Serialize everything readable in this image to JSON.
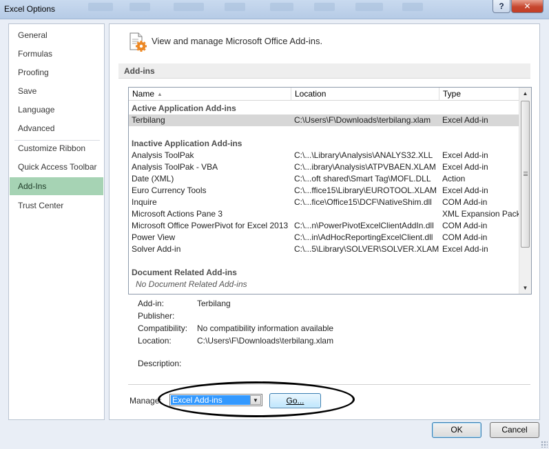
{
  "window": {
    "title": "Excel Options",
    "help_label": "?",
    "close_label": "✕"
  },
  "nav": {
    "items": [
      {
        "label": "General"
      },
      {
        "label": "Formulas"
      },
      {
        "label": "Proofing"
      },
      {
        "label": "Save"
      },
      {
        "label": "Language"
      },
      {
        "label": "Advanced"
      },
      {
        "label": "Customize Ribbon"
      },
      {
        "label": "Quick Access Toolbar"
      },
      {
        "label": "Add-Ins"
      },
      {
        "label": "Trust Center"
      }
    ],
    "active": "Add-Ins"
  },
  "main": {
    "header_text": "View and manage Microsoft Office Add-ins.",
    "section_title": "Add-ins",
    "columns": {
      "name": "Name",
      "location": "Location",
      "type": "Type"
    },
    "groups": {
      "active": "Active Application Add-ins",
      "inactive": "Inactive Application Add-ins",
      "document": "Document Related Add-ins"
    },
    "active_rows": [
      {
        "name": "Terbilang",
        "location": "C:\\Users\\F\\Downloads\\terbilang.xlam",
        "type": "Excel Add-in"
      }
    ],
    "inactive_rows": [
      {
        "name": "Analysis ToolPak",
        "location": "C:\\...\\Library\\Analysis\\ANALYS32.XLL",
        "type": "Excel Add-in"
      },
      {
        "name": "Analysis ToolPak - VBA",
        "location": "C:\\...ibrary\\Analysis\\ATPVBAEN.XLAM",
        "type": "Excel Add-in"
      },
      {
        "name": "Date (XML)",
        "location": "C:\\...oft shared\\Smart Tag\\MOFL.DLL",
        "type": "Action"
      },
      {
        "name": "Euro Currency Tools",
        "location": "C:\\...ffice15\\Library\\EUROTOOL.XLAM",
        "type": "Excel Add-in"
      },
      {
        "name": "Inquire",
        "location": "C:\\...fice\\Office15\\DCF\\NativeShim.dll",
        "type": "COM Add-in"
      },
      {
        "name": "Microsoft Actions Pane 3",
        "location": "",
        "type": "XML Expansion Pack"
      },
      {
        "name": "Microsoft Office PowerPivot for Excel 2013",
        "location": "C:\\...n\\PowerPivotExcelClientAddIn.dll",
        "type": "COM Add-in"
      },
      {
        "name": "Power View",
        "location": "C:\\...in\\AdHocReportingExcelClient.dll",
        "type": "COM Add-in"
      },
      {
        "name": "Solver Add-in",
        "location": "C:\\...5\\Library\\SOLVER\\SOLVER.XLAM",
        "type": "Excel Add-in"
      }
    ],
    "document_empty": "No Document Related Add-ins",
    "details": [
      {
        "label": "Add-in:",
        "value": "Terbilang"
      },
      {
        "label": "Publisher:",
        "value": ""
      },
      {
        "label": "Compatibility:",
        "value": "No compatibility information available"
      },
      {
        "label": "Location:",
        "value": "C:\\Users\\F\\Downloads\\terbilang.xlam"
      },
      {
        "label": "Description:",
        "value": ""
      }
    ],
    "manage": {
      "label": "Manage:",
      "selected": "Excel Add-ins",
      "go_label": "Go..."
    }
  },
  "footer": {
    "ok_label": "OK",
    "cancel_label": "Cancel"
  },
  "colors": {
    "nav_active": "#a6d3b4",
    "selection": "#3399ff",
    "close_button": "#c6472f"
  }
}
